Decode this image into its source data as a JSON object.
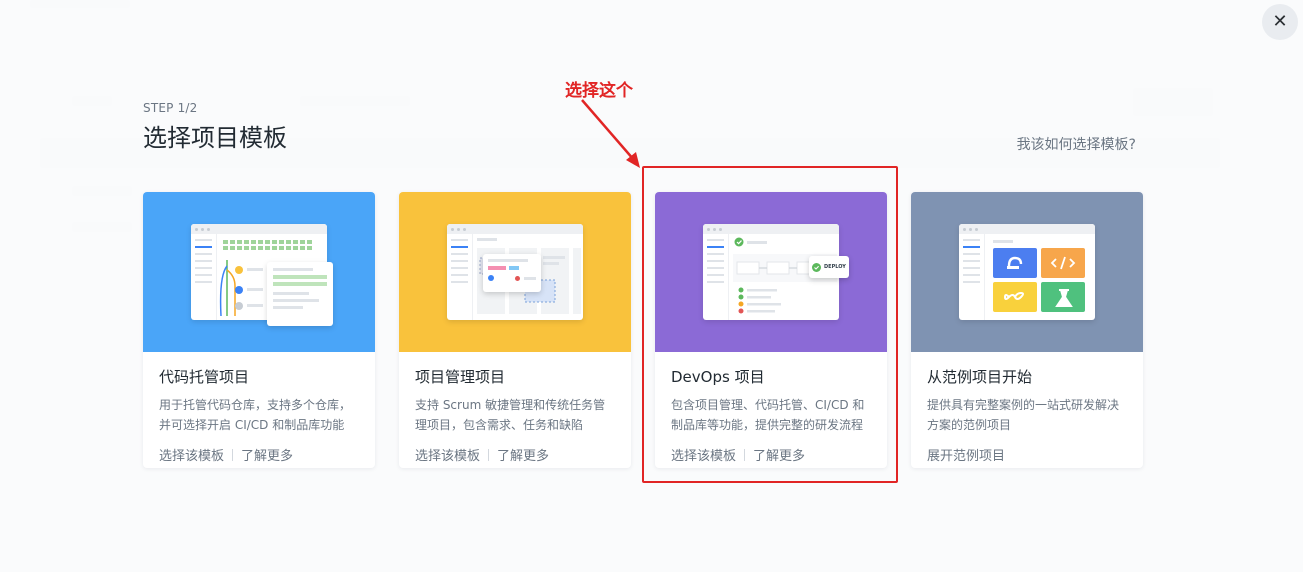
{
  "header": {
    "step": "STEP 1/2",
    "title": "选择项目模板",
    "help_link": "我该如何选择模板?",
    "close_label": "✕"
  },
  "annotation": {
    "callout": "选择这个",
    "color": "#e12525"
  },
  "cards": [
    {
      "title": "代码托管项目",
      "desc": "用于托管代码仓库，支持多个仓库，并可选择开启 CI/CD 和制品库功能",
      "action1": "选择该模板",
      "action2": "了解更多",
      "color": "#4aa5f8",
      "illustration": "git-branch-illustration"
    },
    {
      "title": "项目管理项目",
      "desc": "支持 Scrum 敏捷管理和传统任务管理项目，包含需求、任务和缺陷",
      "action1": "选择该模板",
      "action2": "了解更多",
      "color": "#f9c23c",
      "illustration": "kanban-board-illustration"
    },
    {
      "title": "DevOps 项目",
      "desc": "包含项目管理、代码托管、CI/CD 和制品库等功能，提供完整的研发流程",
      "action1": "选择该模板",
      "action2": "了解更多",
      "color": "#8b6ad6",
      "illustration": "pipeline-deploy-illustration",
      "deploy_badge": "DEPLOY"
    },
    {
      "title": "从范例项目开始",
      "desc": "提供具有完整案例的一站式研发解决方案的范例项目",
      "action1": "展开范例项目",
      "color": "#7f93b2",
      "illustration": "module-tiles-illustration"
    }
  ]
}
